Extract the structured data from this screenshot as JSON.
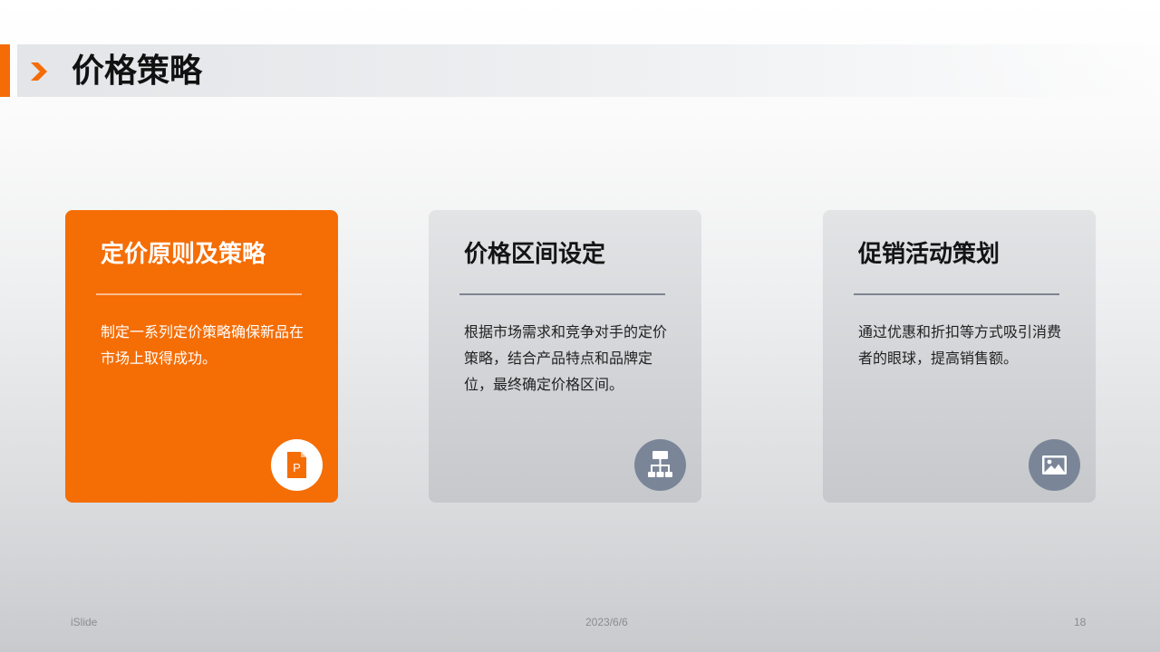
{
  "header": {
    "title": "价格策略",
    "accent_color": "#f56c06",
    "chevron_icon": "chevron-right-icon"
  },
  "cards": [
    {
      "title": "定价原则及策略",
      "description": "制定一系列定价策略确保新品在市场上取得成功。",
      "icon": "powerpoint-file-icon",
      "highlighted": true,
      "color": "#f56d05"
    },
    {
      "title": "价格区间设定",
      "description": "根据市场需求和竞争对手的定价策略，结合产品特点和品牌定位，最终确定价格区间。",
      "icon": "org-chart-icon",
      "highlighted": false,
      "color": "#7a8698"
    },
    {
      "title": "促销活动策划",
      "description": "通过优惠和折扣等方式吸引消费者的眼球，提高销售额。",
      "icon": "image-icon",
      "highlighted": false,
      "color": "#7a8698"
    }
  ],
  "footer": {
    "left": "iSlide",
    "center": "2023/6/6",
    "page_number": "18"
  }
}
